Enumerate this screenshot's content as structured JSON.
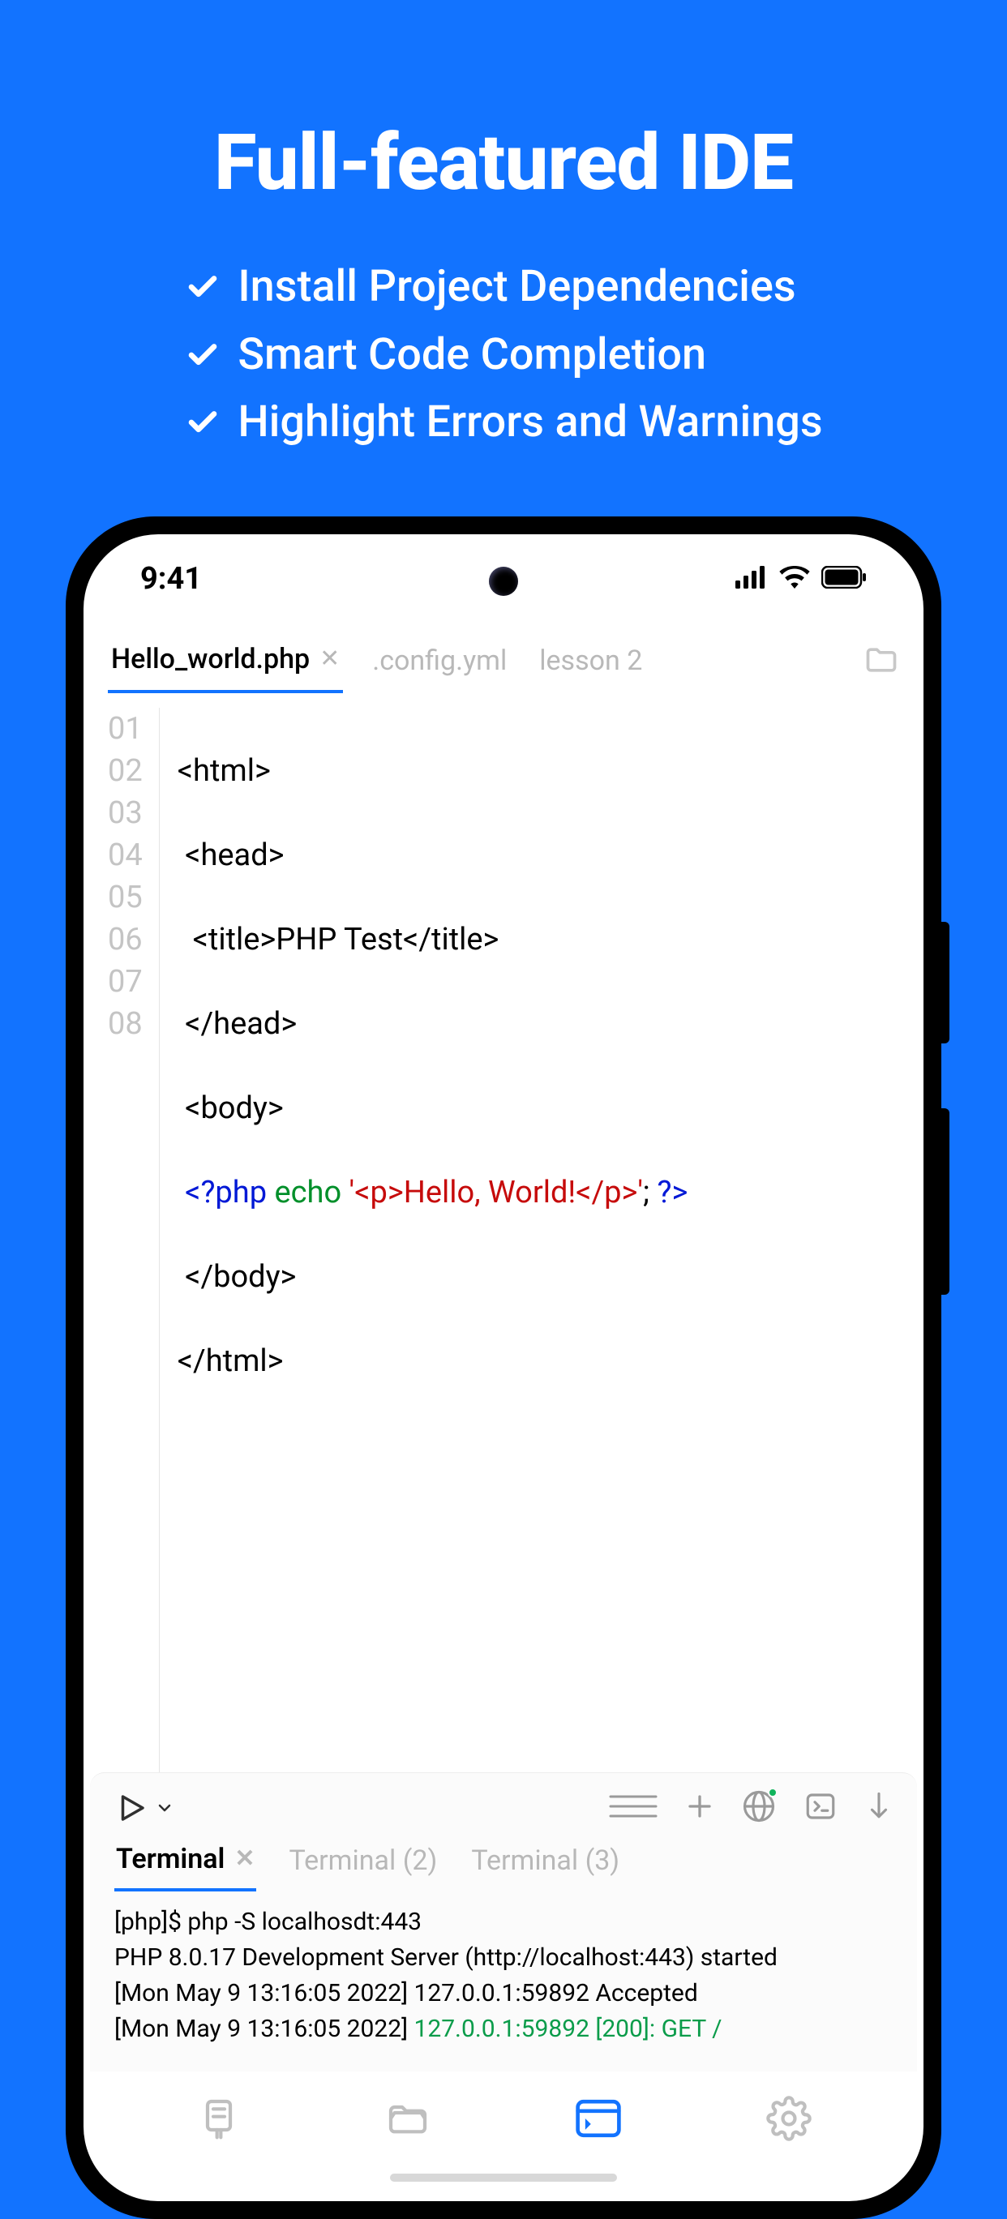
{
  "hero": {
    "title": "Full-featured IDE",
    "features": [
      "Install Project Dependencies",
      "Smart Code Completion",
      "Highlight Errors and Warnings"
    ]
  },
  "status": {
    "time": "9:41"
  },
  "tabs": [
    {
      "label": "Hello_world.php",
      "active": true,
      "closable": true
    },
    {
      "label": ".config.yml",
      "active": false,
      "closable": false
    },
    {
      "label": "lesson 2",
      "active": false,
      "closable": false
    }
  ],
  "code": {
    "line_numbers": [
      "01",
      "02",
      "03",
      "04",
      "05",
      "06",
      "07",
      "08"
    ],
    "lines_plain": [
      "<html>",
      " <head>",
      "  <title>PHP Test</title>",
      " </head>",
      " <body>",
      " <?php echo '<p>Hello, World!</p>'; ?>",
      " </body>",
      "</html>"
    ],
    "php_seg": {
      "indent": " ",
      "open": "<?php",
      "echo": " echo ",
      "string": "'<p>Hello, World!</p>'",
      "semi": "; ",
      "close": "?>"
    }
  },
  "terminal": {
    "tabs": [
      {
        "label": "Terminal",
        "active": true,
        "closable": true
      },
      {
        "label": "Terminal (2)",
        "active": false
      },
      {
        "label": "Terminal (3)",
        "active": false
      }
    ],
    "lines": [
      {
        "plain": "[php]$ php -S localhosdt:443"
      },
      {
        "plain": "PHP 8.0.17 Development Server (http://localhost:443) started"
      },
      {
        "plain": "[Mon May 9 13:16:05 2022] 127.0.0.1:59892 Accepted"
      },
      {
        "prefix": "[Mon May 9 13:16:05 2022] ",
        "green": "127.0.0.1:59892 [200]: GET /"
      }
    ]
  }
}
